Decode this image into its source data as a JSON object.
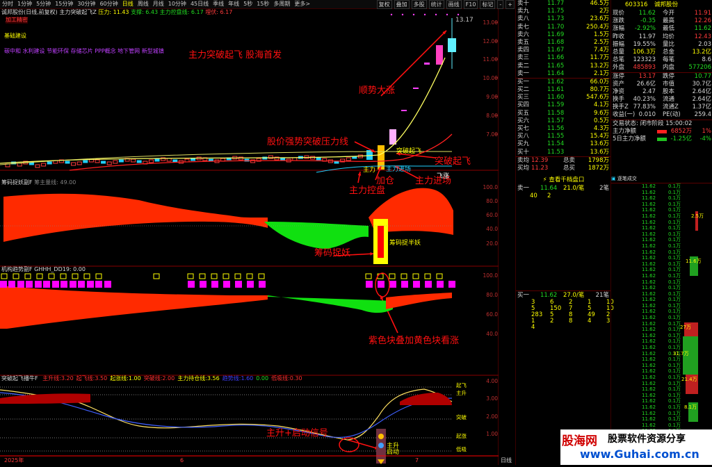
{
  "toolbar": {
    "periods": [
      "分时",
      "1分钟",
      "5分钟",
      "15分钟",
      "30分钟",
      "60分钟",
      "日线",
      "周线",
      "月线",
      "10分钟",
      "45日线",
      "季线",
      "年线",
      "5秒",
      "15秒",
      "多周期",
      "更多>"
    ],
    "active": "日线",
    "right_buttons": [
      "复权",
      "叠加",
      "多股",
      "统计",
      "画线",
      "F10",
      "标记",
      "-",
      "+"
    ]
  },
  "main_panel": {
    "title_stock": "诚邦股份(日线,前复权)",
    "indicator_name": "主力突破起飞Z",
    "pressure_label": "压力: 11.43",
    "support_label": "支撑: 6.43",
    "control_label": "主力控盘线: 6.17",
    "ambush_label": "埋伏: 6.17",
    "buy_tag": "加工精密",
    "basic": "基础建设",
    "concepts": "碳中和 水利建设 节能环保 存储芯片 PPP概念 地下管网 新型城镇",
    "high_label": "13.17",
    "y_ticks": [
      "13.00",
      "12.00",
      "11.00",
      "10.00",
      "9.00",
      "8.00",
      "7.00"
    ],
    "annotations": {
      "title": "主力突破起飞  股海首发",
      "trend": "顺势大涨",
      "breakthrough": "股价强势突破压力线",
      "takeoff": "突破起飞",
      "add": "加仓",
      "control": "主力控盘",
      "enter": "主力进场"
    },
    "small_tags": {
      "takeoff": "突破起飞",
      "enter": "主力进场",
      "main": "主力",
      "fly": "飞涨"
    }
  },
  "panel2": {
    "title": "筹码捉妖副F",
    "param": "筹主量线: 49.00",
    "y_ticks": [
      "100.0",
      "80.0",
      "60.0",
      "40.0",
      "20.0"
    ],
    "annotation": "筹码捉妖",
    "tag": "筹码捉半妖"
  },
  "panel3": {
    "title": "机构趋势副F",
    "param": "GHHH_DD19: 0.00",
    "y_ticks": [
      "100.0",
      "80.0",
      "60.0",
      "40.0"
    ],
    "annotation": "紫色块叠加黄色块看涨"
  },
  "panel4": {
    "title": "突破起飞播牛F",
    "params": [
      {
        "label": "主升线:",
        "value": "3.20",
        "color": "#ff3030"
      },
      {
        "label": "起飞线:",
        "value": "3.50",
        "color": "#ff3030"
      },
      {
        "label": "起涨线:",
        "value": "1.00",
        "color": "#ffff00"
      },
      {
        "label": "突破线:",
        "value": "2.00",
        "color": "#ff3030"
      },
      {
        "label": "主力持仓线:",
        "value": "3.56",
        "color": "#ffff00"
      },
      {
        "label": "趋势线:",
        "value": "1.60",
        "color": "#4040ff"
      },
      {
        "label": "",
        "value": "0.00",
        "color": "#22dd22"
      },
      {
        "label": "低吸线:",
        "value": "0.30",
        "color": "#ff3030"
      }
    ],
    "y_ticks": [
      "4.00",
      "3.00",
      "2.00",
      "1.00"
    ],
    "right_labels": [
      "起飞",
      "主升",
      "突破",
      "起涨",
      "低吸"
    ],
    "annotation": "主升+启动信号",
    "signal_tags": [
      "主升",
      "启动"
    ]
  },
  "x_axis": {
    "labels": [
      "2025年",
      "6",
      "7"
    ],
    "period": "日线"
  },
  "quote": {
    "code": "603316",
    "name": "诚邦股份",
    "sells": [
      {
        "label": "卖十",
        "price": "11.77",
        "vol": "46.5万"
      },
      {
        "label": "卖九",
        "price": "11.75",
        "vol": "2万"
      },
      {
        "label": "卖八",
        "price": "11.73",
        "vol": "23.6万"
      },
      {
        "label": "卖七",
        "price": "11.70",
        "vol": "250.4万"
      },
      {
        "label": "卖六",
        "price": "11.69",
        "vol": "1.5万"
      },
      {
        "label": "卖五",
        "price": "11.68",
        "vol": "2.5万"
      },
      {
        "label": "卖四",
        "price": "11.67",
        "vol": "7.4万"
      },
      {
        "label": "卖三",
        "price": "11.66",
        "vol": "11.7万"
      },
      {
        "label": "卖二",
        "price": "11.65",
        "vol": "13.2万"
      },
      {
        "label": "卖一",
        "price": "11.64",
        "vol": "2.1万"
      }
    ],
    "buys": [
      {
        "label": "买一",
        "price": "11.62",
        "vol": "66.0万"
      },
      {
        "label": "买二",
        "price": "11.61",
        "vol": "80.7万"
      },
      {
        "label": "买三",
        "price": "11.60",
        "vol": "547.6万"
      },
      {
        "label": "买四",
        "price": "11.59",
        "vol": "4.1万"
      },
      {
        "label": "买五",
        "price": "11.58",
        "vol": "9.6万"
      },
      {
        "label": "买六",
        "price": "11.57",
        "vol": "0.5万"
      },
      {
        "label": "买七",
        "price": "11.56",
        "vol": "4.3万"
      },
      {
        "label": "买八",
        "price": "11.55",
        "vol": "15.4万"
      },
      {
        "label": "买九",
        "price": "11.54",
        "vol": "13.6万"
      },
      {
        "label": "买十",
        "price": "11.53",
        "vol": "13.6万"
      }
    ],
    "avg_sell": {
      "label": "卖均",
      "price": "12.39",
      "tlabel": "总卖",
      "vol": "1798万"
    },
    "avg_buy": {
      "label": "买均",
      "price": "11.23",
      "tlabel": "总买",
      "vol": "1872万"
    },
    "view_link": "查看千档盘口",
    "level_sell": {
      "label": "卖一",
      "price": "11.64",
      "vol": "21.0/笔",
      "count": "2笔"
    },
    "level_sell_row": [
      "40",
      "2"
    ],
    "level_buy": {
      "label": "买一",
      "price": "11.62",
      "vol": "27.0/笔",
      "count": "21笔"
    },
    "level_buy_rows": [
      [
        "3",
        "6",
        "2",
        "1",
        "10"
      ],
      [
        "5",
        "150",
        "7",
        "5",
        "10"
      ],
      [
        "283",
        "5",
        "8",
        "49",
        "2"
      ],
      [
        "1",
        "2",
        "8",
        "4",
        "3"
      ],
      [
        "4",
        "",
        "",
        "",
        ""
      ]
    ],
    "stats": [
      {
        "l1": "现价",
        "v1": "11.62",
        "l2": "今开",
        "v2": "11.91"
      },
      {
        "l1": "涨跌",
        "v1": "-0.35",
        "l2": "最高",
        "v2": "12.26"
      },
      {
        "l1": "涨幅",
        "v1": "-2.92%",
        "l2": "最低",
        "v2": "11.62"
      },
      {
        "l1": "昨收",
        "v1": "11.97",
        "l2": "均价",
        "v2": "12.43"
      },
      {
        "l1": "振幅",
        "v1": "19.55%",
        "l2": "量比",
        "v2": "2.03"
      },
      {
        "l1": "总量",
        "v1": "106.3万",
        "l2": "总金",
        "v2": "13.2亿"
      },
      {
        "l1": "总笔",
        "v1": "123323",
        "l2": "每笔",
        "v2": "8.6"
      },
      {
        "l1": "外盘",
        "v1": "485893",
        "l2": "内盘",
        "v2": "577206"
      },
      {
        "l1": "涨停",
        "v1": "13.17",
        "l2": "跌停",
        "v2": "10.77"
      },
      {
        "l1": "资产",
        "v1": "26.6亿",
        "l2": "市值",
        "v2": "30.7亿"
      },
      {
        "l1": "净资",
        "v1": "2.47",
        "l2": "股本",
        "v2": "2.64亿"
      },
      {
        "l1": "换手",
        "v1": "40.23%",
        "l2": "流通",
        "v2": "2.64亿"
      },
      {
        "l1": "换手Z",
        "v1": "77.83%",
        "l2": "流通Z",
        "v2": "1.37亿"
      },
      {
        "l1": "收益(一)",
        "v1": "0.010",
        "l2": "PE(动)",
        "v2": "259.4"
      }
    ],
    "trade_status": "交易状态: 闭市阶段 15:00:02",
    "main_net": {
      "label": "主力净额",
      "value": "6852万",
      "pct": "1%"
    },
    "main_net5": {
      "label": "5日主力净额",
      "value": "-1.25亿",
      "pct": "-4%"
    },
    "ticks_title": "逐笔成交",
    "ticks": [
      [
        "11.62",
        "0.1万"
      ],
      [
        "11.62",
        "0.1万"
      ],
      [
        "11.62",
        "0.1万"
      ],
      [
        "11.62",
        "0.1万"
      ],
      [
        "11.62",
        "0.1万"
      ],
      [
        "11.62",
        "0.1万"
      ],
      [
        "11.62",
        "0.1万"
      ],
      [
        "11.62",
        "0.1万"
      ],
      [
        "11.62",
        "0.1万"
      ],
      [
        "11.62",
        "0.1万"
      ],
      [
        "11.62",
        "0.1万"
      ],
      [
        "11.62",
        "0.1万"
      ],
      [
        "11.62",
        "0.1万"
      ],
      [
        "11.62",
        "0.1万"
      ],
      [
        "11.62",
        "0.1万"
      ],
      [
        "11.62",
        "0.1万"
      ],
      [
        "11.62",
        "0.1万"
      ],
      [
        "11.62",
        "0.1万"
      ],
      [
        "11.62",
        "0.1万"
      ],
      [
        "11.62",
        "0.1万"
      ],
      [
        "11.62",
        "0.1万"
      ],
      [
        "11.62",
        "0.1万"
      ],
      [
        "11.62",
        "0.1万"
      ],
      [
        "11.62",
        "0.1万"
      ],
      [
        "11.62",
        "0.1万"
      ],
      [
        "11.62",
        "0.1万"
      ],
      [
        "11.62",
        "0.1万"
      ],
      [
        "11.62",
        "0.1万"
      ],
      [
        "11.62",
        "0.1万"
      ],
      [
        "11.62",
        "0.1万"
      ],
      [
        "11.62",
        "0.1万"
      ],
      [
        "11.62",
        "0.1万"
      ],
      [
        "11.62",
        "0.1万"
      ],
      [
        "11.62",
        "0.1万"
      ],
      [
        "11.62",
        "0.1万"
      ],
      [
        "11.62",
        "0.1万"
      ],
      [
        "11.62",
        "0.1万"
      ],
      [
        "11.62",
        "0.1万"
      ],
      [
        "11.62",
        "0.1万"
      ],
      [
        "11.62",
        "0.1万"
      ],
      [
        "11.62",
        "0.1万"
      ],
      [
        "11.62",
        "0.1万"
      ],
      [
        "11.62",
        "0.1万"
      ],
      [
        "11.62",
        "0.1万"
      ],
      [
        "11.62",
        "0.1万"
      ]
    ],
    "volume_bars": [
      {
        "label": "2.5万"
      },
      {
        "label": "11.6万"
      },
      {
        "label": "27万"
      },
      {
        "label": "31.7万"
      },
      {
        "label": "21.4万"
      },
      {
        "label": "8.1万"
      },
      {
        "label": "6.2万"
      }
    ]
  },
  "watermark": {
    "site": "股海网",
    "slogan": "股票软件资源分享",
    "url": "www.Guhai.com.cn"
  },
  "colors": {
    "up": "#ff3b3b",
    "down": "#22dd22",
    "bg": "#000000",
    "accent": "#ffff00",
    "grid": "#5a0000"
  }
}
